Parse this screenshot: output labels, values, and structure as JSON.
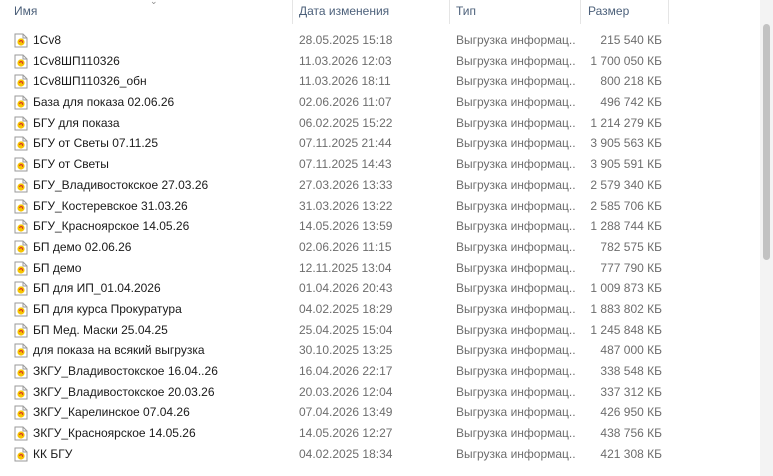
{
  "columns": {
    "name": "Имя",
    "date": "Дата изменения",
    "type": "Тип",
    "size": "Размер"
  },
  "files": [
    {
      "name": "1Cv8",
      "date": "28.05.2025 15:18",
      "type": "Выгрузка информац...",
      "size": "215 540 КБ"
    },
    {
      "name": "1Cv8ШП110326",
      "date": "11.03.2026 12:03",
      "type": "Выгрузка информац...",
      "size": "1 700 050 КБ"
    },
    {
      "name": "1Cv8ШП110326_обн",
      "date": "11.03.2026 18:11",
      "type": "Выгрузка информац...",
      "size": "800 218 КБ"
    },
    {
      "name": "База для показа 02.06.26",
      "date": "02.06.2026 11:07",
      "type": "Выгрузка информац...",
      "size": "496 742 КБ"
    },
    {
      "name": "БГУ для показа",
      "date": "06.02.2025 15:22",
      "type": "Выгрузка информац...",
      "size": "1 214 279 КБ"
    },
    {
      "name": "БГУ от Светы 07.11.25",
      "date": "07.11.2025 21:44",
      "type": "Выгрузка информац...",
      "size": "3 905 563 КБ"
    },
    {
      "name": "БГУ от Светы",
      "date": "07.11.2025 14:43",
      "type": "Выгрузка информац...",
      "size": "3 905 591 КБ"
    },
    {
      "name": "БГУ_Владивостокское 27.03.26",
      "date": "27.03.2026 13:33",
      "type": "Выгрузка информац...",
      "size": "2 579 340 КБ"
    },
    {
      "name": "БГУ_Костеревское 31.03.26",
      "date": "31.03.2026 13:22",
      "type": "Выгрузка информац...",
      "size": "2 585 706 КБ"
    },
    {
      "name": "БГУ_Красноярское 14.05.26",
      "date": "14.05.2026 13:59",
      "type": "Выгрузка информац...",
      "size": "1 288 744 КБ"
    },
    {
      "name": "БП демо 02.06.26",
      "date": "02.06.2026 11:15",
      "type": "Выгрузка информац...",
      "size": "782 575 КБ"
    },
    {
      "name": "БП демо",
      "date": "12.11.2025 13:04",
      "type": "Выгрузка информац...",
      "size": "777 790 КБ"
    },
    {
      "name": "БП для ИП_01.04.2026",
      "date": "01.04.2026 20:43",
      "type": "Выгрузка информац...",
      "size": "1 009 873 КБ"
    },
    {
      "name": "БП для курса Прокуратура",
      "date": "04.02.2025 18:29",
      "type": "Выгрузка информац...",
      "size": "1 883 802 КБ"
    },
    {
      "name": "БП Мед. Маски 25.04.25",
      "date": "25.04.2025 15:04",
      "type": "Выгрузка информац...",
      "size": "1 245 848 КБ"
    },
    {
      "name": "для показа на всякий выгрузка",
      "date": "30.10.2025 13:25",
      "type": "Выгрузка информац...",
      "size": "487 000 КБ"
    },
    {
      "name": "ЗКГУ_Владивостокское 16.04..26",
      "date": "16.04.2026 22:17",
      "type": "Выгрузка информац...",
      "size": "338 548 КБ"
    },
    {
      "name": "ЗКГУ_Владивостокское 20.03.26",
      "date": "20.03.2026 12:04",
      "type": "Выгрузка информац...",
      "size": "337 312 КБ"
    },
    {
      "name": "ЗКГУ_Карелинское 07.04.26",
      "date": "07.04.2026 13:49",
      "type": "Выгрузка информац...",
      "size": "426 950 КБ"
    },
    {
      "name": "ЗКГУ_Красноярское 14.05.26",
      "date": "14.05.2026 12:27",
      "type": "Выгрузка информац...",
      "size": "438 756 КБ"
    },
    {
      "name": "КК БГУ",
      "date": "04.02.2025 18:34",
      "type": "Выгрузка информац...",
      "size": "421 308 КБ"
    }
  ],
  "icon": "1c-file-icon",
  "colors": {
    "icon_yellow": "#f5c400",
    "icon_red": "#d8362a",
    "header_text": "#4c607a"
  }
}
